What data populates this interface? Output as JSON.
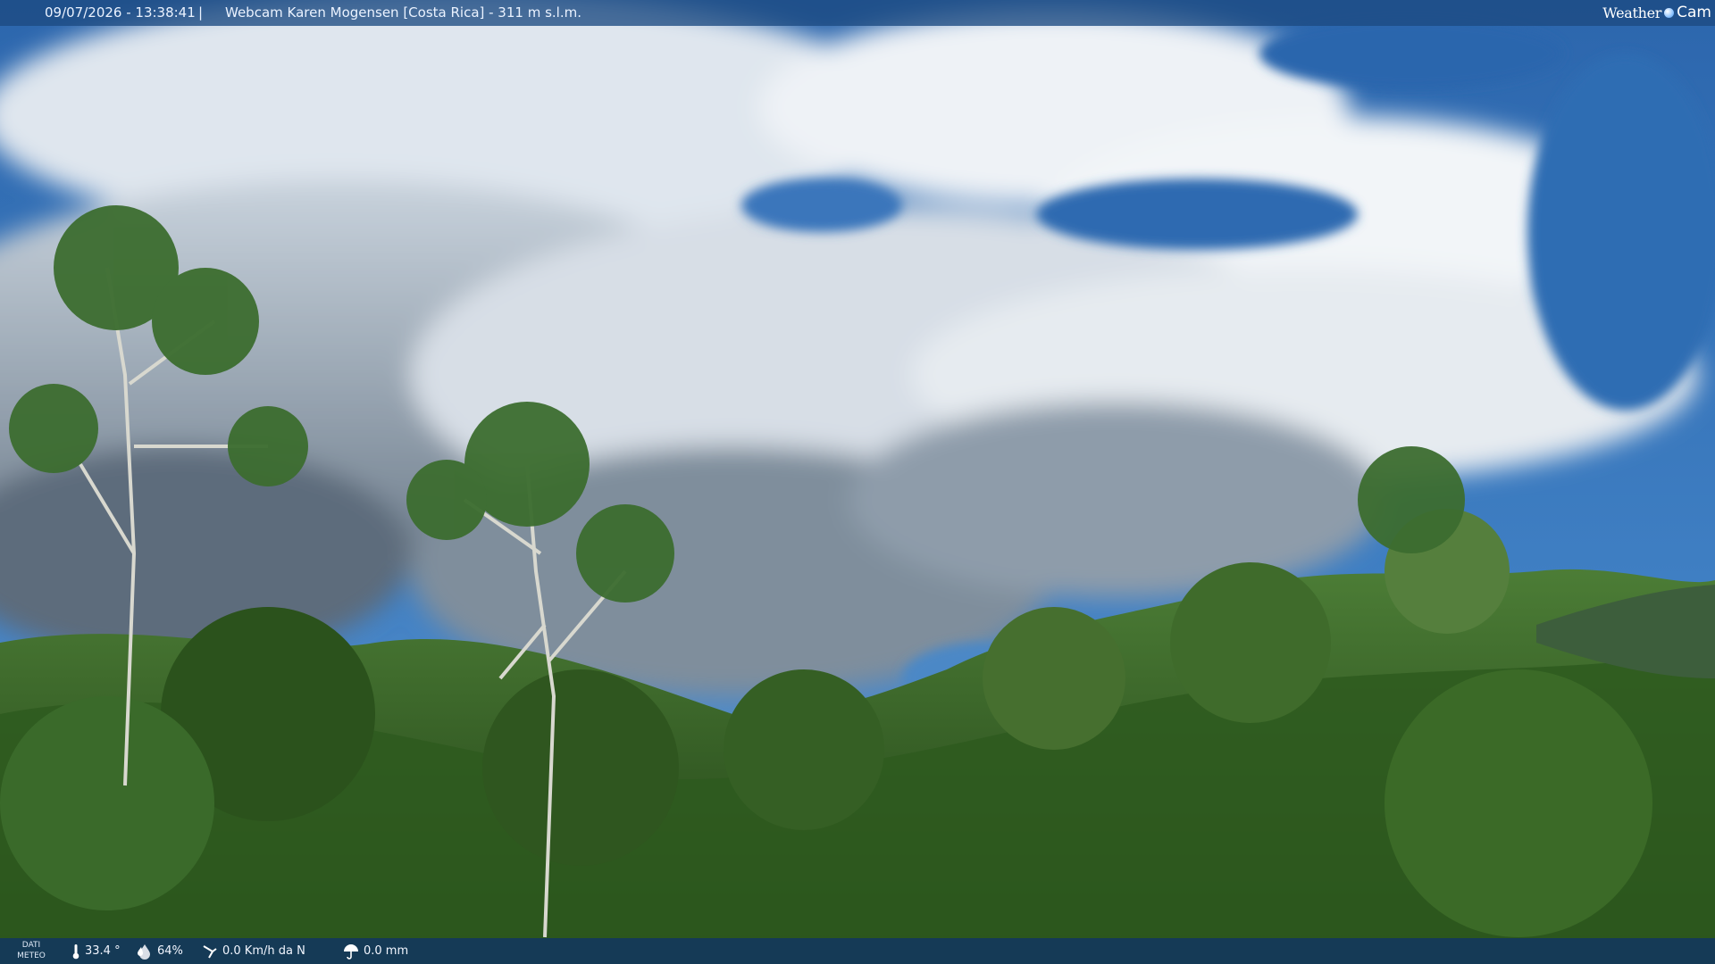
{
  "header": {
    "datetime": "09/07/2026 - 13:38:41",
    "separator": "|",
    "title": "Webcam Karen Mogensen [Costa Rica]  - 311 m s.l.m."
  },
  "logo": {
    "word_left": "Weather",
    "word_right": "Cam",
    "icon": "globe-dot-icon"
  },
  "footer": {
    "label_line1": "DATI",
    "label_line2": "METEO",
    "temperature": "33.4 °",
    "humidity": "64%",
    "wind": "0.0 Km/h da N",
    "rain": "0.0 mm",
    "icons": [
      "thermometer-icon",
      "humidity-drop-icon",
      "wind-icon",
      "rain-umbrella-icon"
    ]
  },
  "colors": {
    "sky": "#2f6fb2",
    "forest": "#2f5a22",
    "bar": "#1c4a82"
  }
}
